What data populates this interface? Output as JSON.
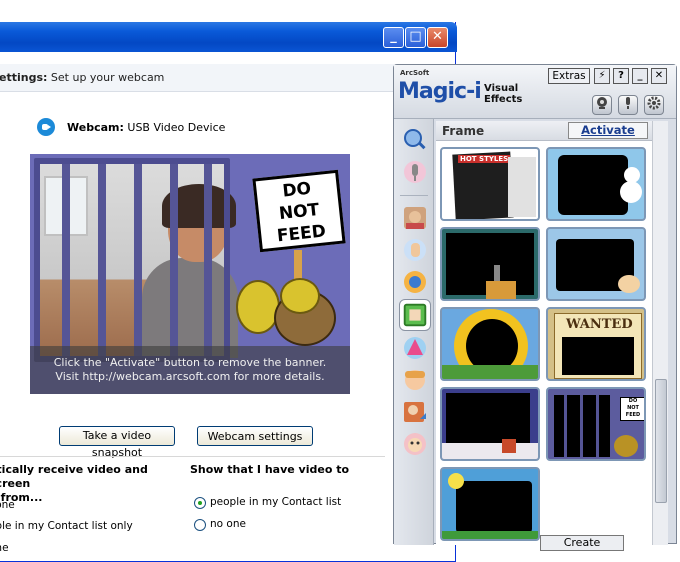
{
  "back_window": {
    "step_label": "ettings:",
    "step_text": "Set up your webcam",
    "webcam_label": "Webcam:",
    "webcam_device": "USB Video Device",
    "banner_line1": "Click the \"Activate\" button to remove the banner.",
    "banner_line2": "Visit http://webcam.arcsoft.com for more details.",
    "sign_text": [
      "DO",
      "NOT",
      "FEED"
    ],
    "snapshot_button": "Take a video snapshot",
    "settings_button": "Webcam settings",
    "receive_heading": "atically receive video and screen\nn from...",
    "receive_options": [
      "yone",
      "ople in my Contact list only",
      "one"
    ],
    "show_heading": "Show that I have video to",
    "show_options": [
      "people in my Contact list",
      "no one"
    ],
    "show_selected": 0,
    "title_buttons": {
      "minimize": "_",
      "maximize": "□",
      "close": "✕"
    }
  },
  "magic_window": {
    "brand": "ArcSoft",
    "logo": "Magic-i",
    "logo_sub": [
      "Visual",
      "Effects"
    ],
    "extras_label": "Extras",
    "window_buttons": [
      "⚡",
      "?",
      "_",
      "✕"
    ],
    "panel_title": "Frame",
    "activate_label": "Activate",
    "create_label": "Create",
    "thumbnail_text": {
      "hot_styles": "HOT STYLES",
      "wanted": "WANTED",
      "do_not_feed": [
        "DO",
        "NOT",
        "FEED"
      ]
    },
    "colors": {
      "logo": "#1f4fa8",
      "activate": "#1a3d8f",
      "title_bar": "#0348c4"
    }
  }
}
